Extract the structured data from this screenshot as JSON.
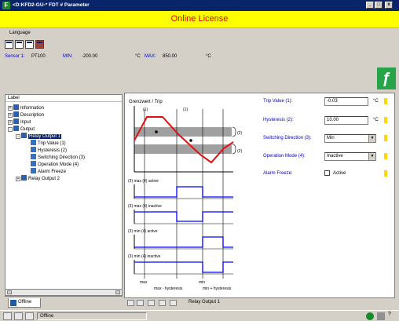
{
  "window": {
    "title": "<D:KFD2-GU-* FDT # Parameter",
    "minimize": "_",
    "maximize": "□",
    "close": "x"
  },
  "banner": {
    "text": "Online License"
  },
  "menu": {
    "items": [
      "Language"
    ]
  },
  "toolbar": {
    "icons": [
      "view-icon",
      "table-icon",
      "list-icon",
      "book-icon"
    ]
  },
  "info": {
    "sensor_label": "Sensor 1:",
    "sensor_value": "PT100",
    "min_label": "MIN:",
    "min_value": "-200.00",
    "unit1": "°C",
    "max_label": "MAX:",
    "max_value": "850.00",
    "unit2": "°C"
  },
  "tree": {
    "header": "Label",
    "items": [
      {
        "label": "Information",
        "expander": "+"
      },
      {
        "label": "Description",
        "expander": "+"
      },
      {
        "label": "Input",
        "expander": "+"
      },
      {
        "label": "Output",
        "expander": "-"
      },
      {
        "label": "Relay Output 1",
        "expander": "-"
      },
      {
        "label": "Trip Value (1)"
      },
      {
        "label": "Hysteresis (2)"
      },
      {
        "label": "Switching Direction (3)"
      },
      {
        "label": "Operation Mode (4)"
      },
      {
        "label": "Alarm Freeze"
      },
      {
        "label": "Relay Output 2",
        "expander": "+"
      }
    ]
  },
  "tabs": {
    "offline": "Offline"
  },
  "diagram": {
    "title": "Grenzwert / Trip",
    "marker1": "(1)",
    "marker2": "(2)",
    "rows": [
      "(3) max  (4) active",
      "(3) max  (4) inactive",
      "(3) min  (4) active",
      "(3) min  (4) inactive"
    ],
    "x_max": "max",
    "x_max_hyst": "max - hysteresis",
    "x_min": "min",
    "x_min_hyst": "min + hysteresis"
  },
  "params": {
    "trip_label": "Trip Value (1):",
    "trip_value": "-0.03",
    "trip_unit": "°C",
    "hyst_label": "Hysteresis (2):",
    "hyst_value": "10.00",
    "hyst_unit": "°C",
    "switch_label": "Switching Direction (3):",
    "switch_value": "Min",
    "opmode_label": "Operation Mode (4):",
    "opmode_value": "Inactive",
    "freeze_label": "Alarm Freeze:",
    "freeze_value": "Active",
    "dropdown_arrow": "▼"
  },
  "nav": {
    "location": "Relay Output 1"
  },
  "status": {
    "text": "Offline"
  },
  "colors": {
    "banner_bg": "#ffff00",
    "banner_text": "#e00000",
    "curve": "#e01010",
    "signal": "#0000ff",
    "logo": "#27a34a"
  }
}
